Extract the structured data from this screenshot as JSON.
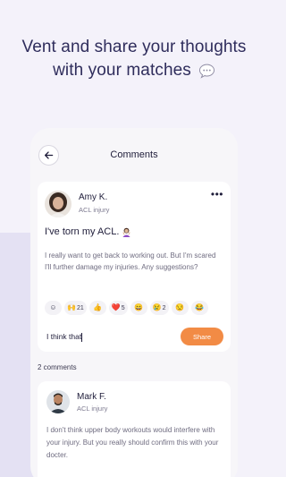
{
  "headline": {
    "line1": "Vent and share your thoughts",
    "line2": "with your matches"
  },
  "screen": {
    "title": "Comments"
  },
  "post": {
    "author": "Amy K.",
    "tag": "ACL injury",
    "title": "I've torn my ACL.",
    "body": "I really want to get back to working out. But I'm scared I'll further damage my injuries. Any suggestions?",
    "reactions": [
      {
        "icon": "add-reaction-icon",
        "emoji": "☺",
        "count": ""
      },
      {
        "icon": "raised-hands-icon",
        "emoji": "🙌",
        "count": "21"
      },
      {
        "icon": "thumbs-up-icon",
        "emoji": "👍",
        "count": ""
      },
      {
        "icon": "heart-icon",
        "emoji": "❤️",
        "count": "5"
      },
      {
        "icon": "grinning-face-icon",
        "emoji": "😄",
        "count": ""
      },
      {
        "icon": "sad-face-icon",
        "emoji": "😢",
        "count": "2"
      },
      {
        "icon": "unamused-face-icon",
        "emoji": "😒",
        "count": ""
      },
      {
        "icon": "laughing-face-icon",
        "emoji": "😂",
        "count": ""
      }
    ],
    "reply_value": "I think that",
    "share_label": "Share"
  },
  "comments_count": "2 comments",
  "comment": {
    "author": "Mark F.",
    "tag": "ACL injury",
    "body": "I don't think upper body workouts would interfere with your injury. But you really should confirm this with your docter."
  },
  "colors": {
    "accent": "#f28b45",
    "headline": "#2f2d5c",
    "background": "#f4f2fa"
  }
}
